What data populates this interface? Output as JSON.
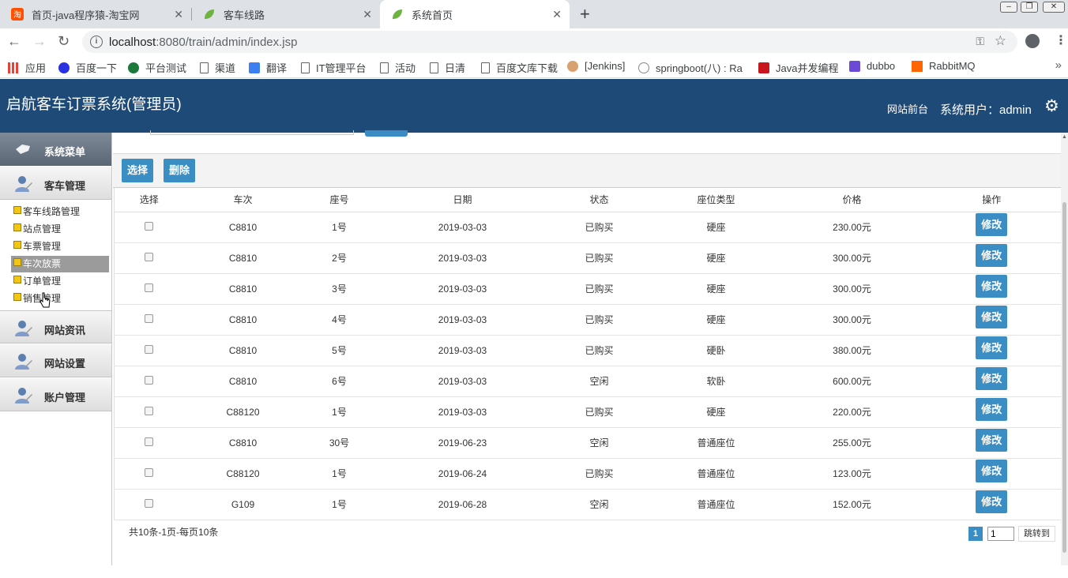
{
  "browser": {
    "tabs": [
      {
        "title": "首页-java程序猿-淘宝网"
      },
      {
        "title": "客车线路"
      },
      {
        "title": "系统首页"
      }
    ],
    "url_host": "localhost",
    "url_rest": ":8080/train/admin/index.jsp",
    "bookmarks": [
      "应用",
      "百度一下",
      "平台测试",
      "渠道",
      "翻译",
      "IT管理平台",
      "活动",
      "日清",
      "百度文库下载",
      "[Jenkins]",
      "springboot(八) : Ra",
      "Java并发编程",
      "dubbo",
      "RabbitMQ"
    ]
  },
  "header": {
    "title": "启航客车订票系统(管理员)",
    "front_link": "网站前台",
    "user_label": "系统用户：admin"
  },
  "sidebar": {
    "menu_title": "系统菜单",
    "groups": [
      "客车管理",
      "网站资讯",
      "网站设置",
      "账户管理"
    ],
    "subitems": [
      "客车线路管理",
      "站点管理",
      "车票管理",
      "车次放票",
      "订单管理",
      "销售管理"
    ]
  },
  "toolbar": {
    "select_label": "选择",
    "delete_label": "删除"
  },
  "table": {
    "headers": [
      "选择",
      "车次",
      "座号",
      "日期",
      "状态",
      "座位类型",
      "价格",
      "操作"
    ],
    "edit_label": "修改",
    "rows": [
      [
        "C8810",
        "1号",
        "2019-03-03",
        "已购买",
        "硬座",
        "230.00元"
      ],
      [
        "C8810",
        "2号",
        "2019-03-03",
        "已购买",
        "硬座",
        "300.00元"
      ],
      [
        "C8810",
        "3号",
        "2019-03-03",
        "已购买",
        "硬座",
        "300.00元"
      ],
      [
        "C8810",
        "4号",
        "2019-03-03",
        "已购买",
        "硬座",
        "300.00元"
      ],
      [
        "C8810",
        "5号",
        "2019-03-03",
        "已购买",
        "硬卧",
        "380.00元"
      ],
      [
        "C8810",
        "6号",
        "2019-03-03",
        "空闲",
        "软卧",
        "600.00元"
      ],
      [
        "C88120",
        "1号",
        "2019-03-03",
        "已购买",
        "硬座",
        "220.00元"
      ],
      [
        "C8810",
        "30号",
        "2019-06-23",
        "空闲",
        "普通座位",
        "255.00元"
      ],
      [
        "C88120",
        "1号",
        "2019-06-24",
        "已购买",
        "普通座位",
        "123.00元"
      ],
      [
        "G109",
        "1号",
        "2019-06-28",
        "空闲",
        "普通座位",
        "152.00元"
      ]
    ]
  },
  "footer": {
    "summary": "共10条-1页-每页10条",
    "current_page": "1",
    "page_input": "1",
    "go_label": "跳转到"
  },
  "colors": {
    "header_bg": "#1e4a78",
    "button_blue": "#3a8ec4"
  }
}
